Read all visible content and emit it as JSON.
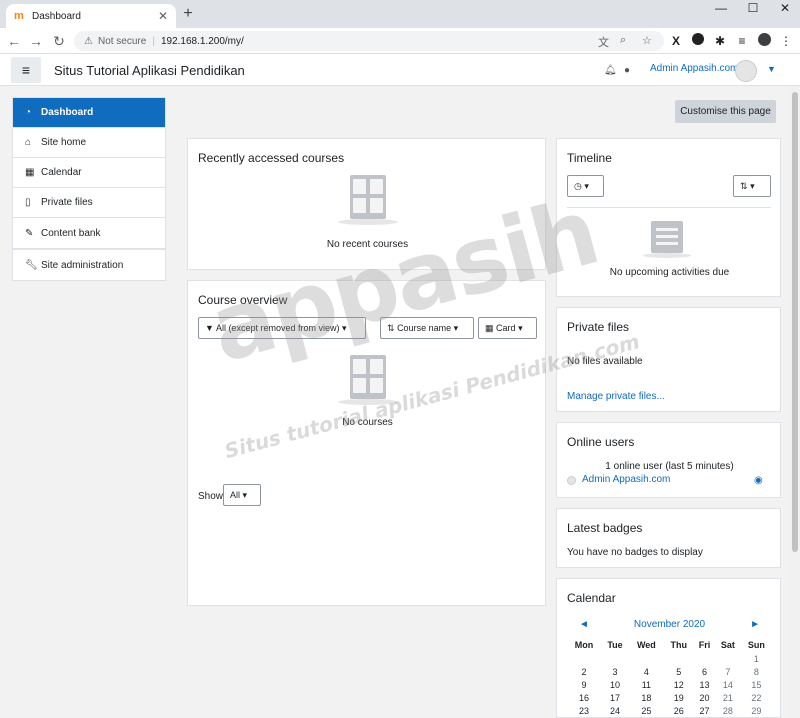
{
  "browser": {
    "tab_title": "Dashboard",
    "tab_close": "✕",
    "new_tab": "+",
    "not_secure": "Not secure",
    "url": "192.168.1.200/my/"
  },
  "navbar": {
    "site_name": "Situs Tutorial Aplikasi Pendidikan",
    "user_name": "Admin Appasih.com"
  },
  "drawer": {
    "items": [
      {
        "label": "Dashboard",
        "icon": "dashboard-icon"
      },
      {
        "label": "Site home",
        "icon": "home-icon"
      },
      {
        "label": "Calendar",
        "icon": "calendar-icon"
      },
      {
        "label": "Private files",
        "icon": "file-icon"
      },
      {
        "label": "Content bank",
        "icon": "brush-icon"
      }
    ],
    "admin": {
      "label": "Site administration",
      "icon": "wrench-icon"
    }
  },
  "main": {
    "customise_label": "Customise this page",
    "recent": {
      "title": "Recently accessed courses",
      "empty": "No recent courses"
    },
    "overview": {
      "title": "Course overview",
      "filter_label": "All (except removed from view)",
      "sort_label": "Course name",
      "view_label": "Card",
      "empty": "No courses",
      "show_label": "Show",
      "show_value": "All"
    }
  },
  "blocks": {
    "timeline": {
      "title": "Timeline",
      "empty": "No upcoming activities due"
    },
    "private_files": {
      "title": "Private files",
      "empty": "No files available",
      "manage_link": "Manage private files..."
    },
    "online_users": {
      "title": "Online users",
      "summary": "1 online user (last 5 minutes)",
      "user": "Admin Appasih.com"
    },
    "badges": {
      "title": "Latest badges",
      "empty": "You have no badges to display"
    },
    "calendar": {
      "title": "Calendar",
      "month": "November 2020",
      "prev": "◄",
      "next": "►",
      "days": [
        "Mon",
        "Tue",
        "Wed",
        "Thu",
        "Fri",
        "Sat",
        "Sun"
      ],
      "weeks": [
        [
          "",
          "",
          "",
          "",
          "",
          "",
          "1"
        ],
        [
          "2",
          "3",
          "4",
          "5",
          "6",
          "7",
          "8"
        ],
        [
          "9",
          "10",
          "11",
          "12",
          "13",
          "14",
          "15"
        ],
        [
          "16",
          "17",
          "18",
          "19",
          "20",
          "21",
          "22"
        ],
        [
          "23",
          "24",
          "25",
          "26",
          "27",
          "28",
          "29"
        ]
      ]
    }
  },
  "watermark": {
    "brand": "appasih",
    "tagline": "Situs tutorial aplikasi Pendidikan.com"
  },
  "colors": {
    "accent": "#0f6cbf",
    "background": "#f2f2f2"
  }
}
